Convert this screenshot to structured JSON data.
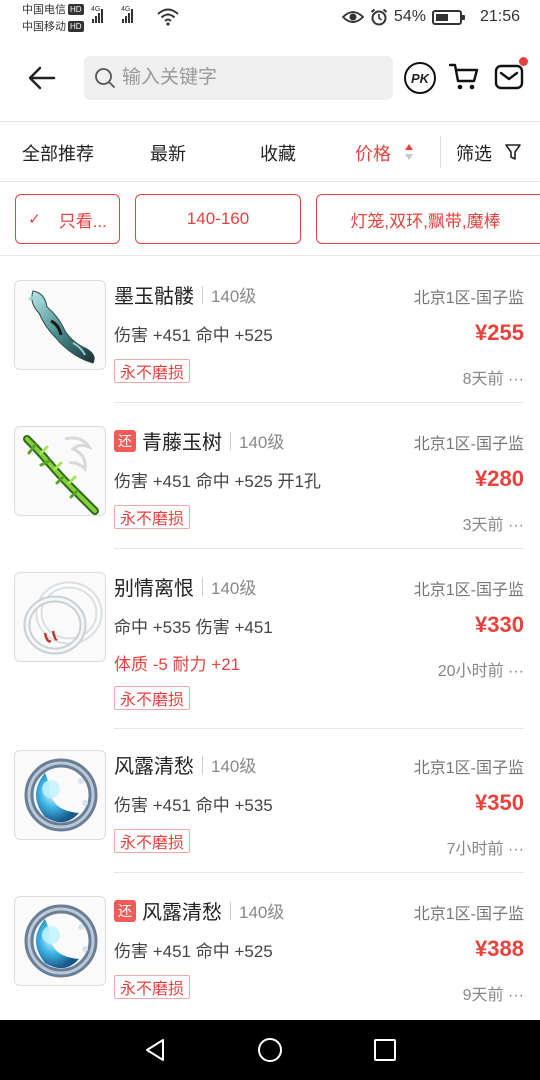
{
  "status_bar": {
    "carrier1": "中国电信",
    "carrier2": "中国移动",
    "hd_label": "HD",
    "network1": "4G",
    "network2": "4G",
    "battery_percent": "54%",
    "battery_level": 0.54,
    "time": "21:56"
  },
  "header": {
    "search_placeholder": "输入关键字",
    "pk_label": "PK",
    "has_unread_message": true
  },
  "tabs": [
    {
      "label": "全部推荐",
      "active": false
    },
    {
      "label": "最新",
      "active": false
    },
    {
      "label": "收藏",
      "active": false
    },
    {
      "label": "价格",
      "active": true
    },
    {
      "label": "筛选",
      "active": false
    }
  ],
  "chips": [
    {
      "check": "✓",
      "label": "只看..."
    },
    {
      "label": "140-160"
    },
    {
      "label": "灯笼,双环,飘带,魔棒"
    }
  ],
  "colors": {
    "accent": "#e8423f",
    "text": "#222222",
    "muted": "#888888",
    "divider": "#e6e6e6"
  },
  "items": [
    {
      "refund_tag": "",
      "name": "墨玉骷髅",
      "level": "140级",
      "server": "北京1区-国子监",
      "attrs": "伤害 +451 命中 +525",
      "attrs_red": "",
      "price": "¥255",
      "badge": "永不磨损",
      "time": "8天前 ···",
      "icon": "jade-skull-wand-icon"
    },
    {
      "refund_tag": "还",
      "name": "青藤玉树",
      "level": "140级",
      "server": "北京1区-国子监",
      "attrs": "伤害 +451 命中 +525 开1孔",
      "attrs_red": "",
      "price": "¥280",
      "badge": "永不磨损",
      "time": "3天前 ···",
      "icon": "green-vine-wand-icon"
    },
    {
      "refund_tag": "",
      "name": "别情离恨",
      "level": "140级",
      "server": "北京1区-国子监",
      "attrs": "命中 +535 伤害 +451",
      "attrs_red": "体质 -5 耐力 +21",
      "price": "¥330",
      "badge": "永不磨损",
      "time": "20小时前 ···",
      "icon": "double-ring-icon"
    },
    {
      "refund_tag": "",
      "name": "风露清愁",
      "level": "140级",
      "server": "北京1区-国子监",
      "attrs": "伤害 +451 命中 +535",
      "attrs_red": "",
      "price": "¥350",
      "badge": "永不磨损",
      "time": "7小时前 ···",
      "icon": "crescent-moon-ring-icon"
    },
    {
      "refund_tag": "还",
      "name": "风露清愁",
      "level": "140级",
      "server": "北京1区-国子监",
      "attrs": "伤害 +451 命中 +525",
      "attrs_red": "",
      "price": "¥388",
      "badge": "永不磨损",
      "time": "9天前 ···",
      "icon": "crescent-moon-ring-icon"
    }
  ]
}
